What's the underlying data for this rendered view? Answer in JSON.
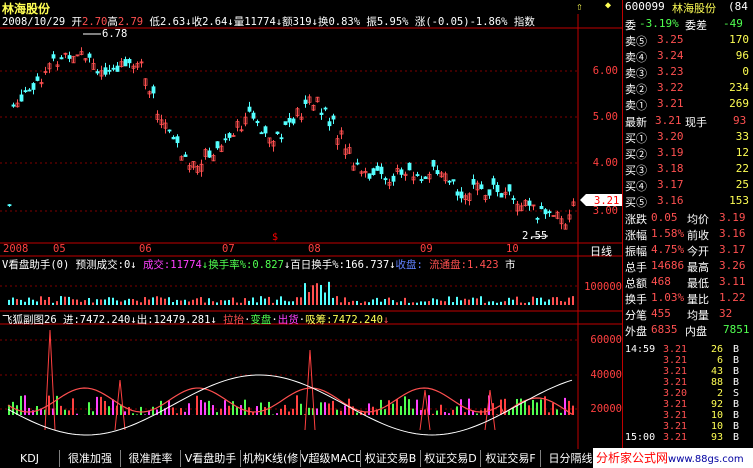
{
  "header": {
    "stock_name": "林海股份",
    "date": "2008/10/29",
    "open_label": "开",
    "open": "2.70",
    "high_label": "高",
    "high": "2.79",
    "low_label": "低",
    "low": "2.63",
    "close_label": "收",
    "close": "2.64",
    "volume_label": "量",
    "volume": "11774",
    "amount_label": "额",
    "amount": "319",
    "turnover_label": "换",
    "turnover": "0.83%",
    "amplitude_label": "振",
    "amplitude": "5.95%",
    "change_label": "涨",
    "change": "(-0.05)-1.86%",
    "index_label": "指数"
  },
  "price_chart": {
    "y_ticks": [
      "6.00",
      "5.00",
      "4.00",
      "3.00"
    ],
    "max_label": "6.78",
    "min_label": "2.55",
    "current_label": "3.21",
    "x_ticks": [
      "2008",
      "05",
      "06",
      "07",
      "08",
      "09",
      "10"
    ],
    "period_label": "日线"
  },
  "volume_panel": {
    "title": "V看盘助手(0)",
    "forecast_label": "预测成交:0",
    "vol_label": "成交:11774",
    "turnover_label": "换手率%:0.827",
    "hundred_label": "百日换手%:166.737",
    "shou_label": "收盘:",
    "liutong_label": "流通盘:1.423",
    "market_label": "市",
    "y_tick": "100000"
  },
  "fox_panel": {
    "title": "飞狐副图26",
    "jin_label": "进:7472.240",
    "chu_label": "出:12479.281",
    "lashen_label": "拉抬",
    "biandian_label": "变盘",
    "chuhuo_label": "出货",
    "xichou_label": "吸筹:7472.240",
    "y_ticks": [
      "60000",
      "40000",
      "20000"
    ]
  },
  "tabs": [
    "KDJ",
    "很准加强",
    "很准胜率",
    "V看盘助手",
    "机构K线(修",
    "V超级MACD",
    "权证交易B",
    "权证交易D",
    "权证交易F",
    "日分隔线"
  ],
  "sidebar": {
    "code": "600099",
    "name": "林海股份",
    "num": "(84",
    "wei_bi_label": "委",
    "wei_bi": "-3.19%",
    "wei_cha_label": "委差",
    "wei_cha": "-49",
    "sell": [
      {
        "label": "卖⑤",
        "price": "3.25",
        "vol": "170"
      },
      {
        "label": "卖④",
        "price": "3.24",
        "vol": "96"
      },
      {
        "label": "卖③",
        "price": "3.23",
        "vol": "0"
      },
      {
        "label": "卖②",
        "price": "3.22",
        "vol": "234"
      },
      {
        "label": "卖①",
        "price": "3.21",
        "vol": "269"
      }
    ],
    "latest_label": "最新",
    "latest": "3.21",
    "xianshou_label": "现手",
    "xianshou": "93",
    "buy": [
      {
        "label": "买①",
        "price": "3.20",
        "vol": "33"
      },
      {
        "label": "买②",
        "price": "3.19",
        "vol": "12"
      },
      {
        "label": "买③",
        "price": "3.18",
        "vol": "22"
      },
      {
        "label": "买④",
        "price": "3.17",
        "vol": "25"
      },
      {
        "label": "买⑤",
        "price": "3.16",
        "vol": "153"
      }
    ],
    "stats": [
      {
        "l1": "涨跌",
        "v1": "0.05",
        "l2": "均价",
        "v2": "3.19"
      },
      {
        "l1": "涨幅",
        "v1": "1.58%",
        "l2": "前收",
        "v2": "3.16"
      },
      {
        "l1": "振幅",
        "v1": "4.75%",
        "l2": "今开",
        "v2": "3.17"
      },
      {
        "l1": "总手",
        "v1": "14686",
        "l2": "最高",
        "v2": "3.26"
      },
      {
        "l1": "总额",
        "v1": "468",
        "l2": "最低",
        "v2": "3.11"
      },
      {
        "l1": "换手",
        "v1": "1.03%",
        "l2": "量比",
        "v2": "1.22"
      },
      {
        "l1": "分笔",
        "v1": "455",
        "l2": "均量",
        "v2": "32"
      }
    ],
    "waipan_label": "外盘",
    "waipan": "6835",
    "neipan_label": "内盘",
    "neipan": "7851",
    "ticks": [
      {
        "time": "14:59",
        "price": "3.21",
        "vol": "26",
        "side": "B"
      },
      {
        "time": "",
        "price": "3.21",
        "vol": "6",
        "side": "B"
      },
      {
        "time": "",
        "price": "3.21",
        "vol": "43",
        "side": "B"
      },
      {
        "time": "",
        "price": "3.21",
        "vol": "88",
        "side": "B"
      },
      {
        "time": "",
        "price": "3.20",
        "vol": "2",
        "side": "S"
      },
      {
        "time": "",
        "price": "3.21",
        "vol": "92",
        "side": "B"
      },
      {
        "time": "",
        "price": "3.21",
        "vol": "10",
        "side": "B"
      },
      {
        "time": "",
        "price": "3.21",
        "vol": "10",
        "side": "B"
      },
      {
        "time": "15:00",
        "price": "3.21",
        "vol": "93",
        "side": "B"
      }
    ],
    "watermark": "分析家公式网",
    "watermark_url": "www.88gs.com"
  }
}
